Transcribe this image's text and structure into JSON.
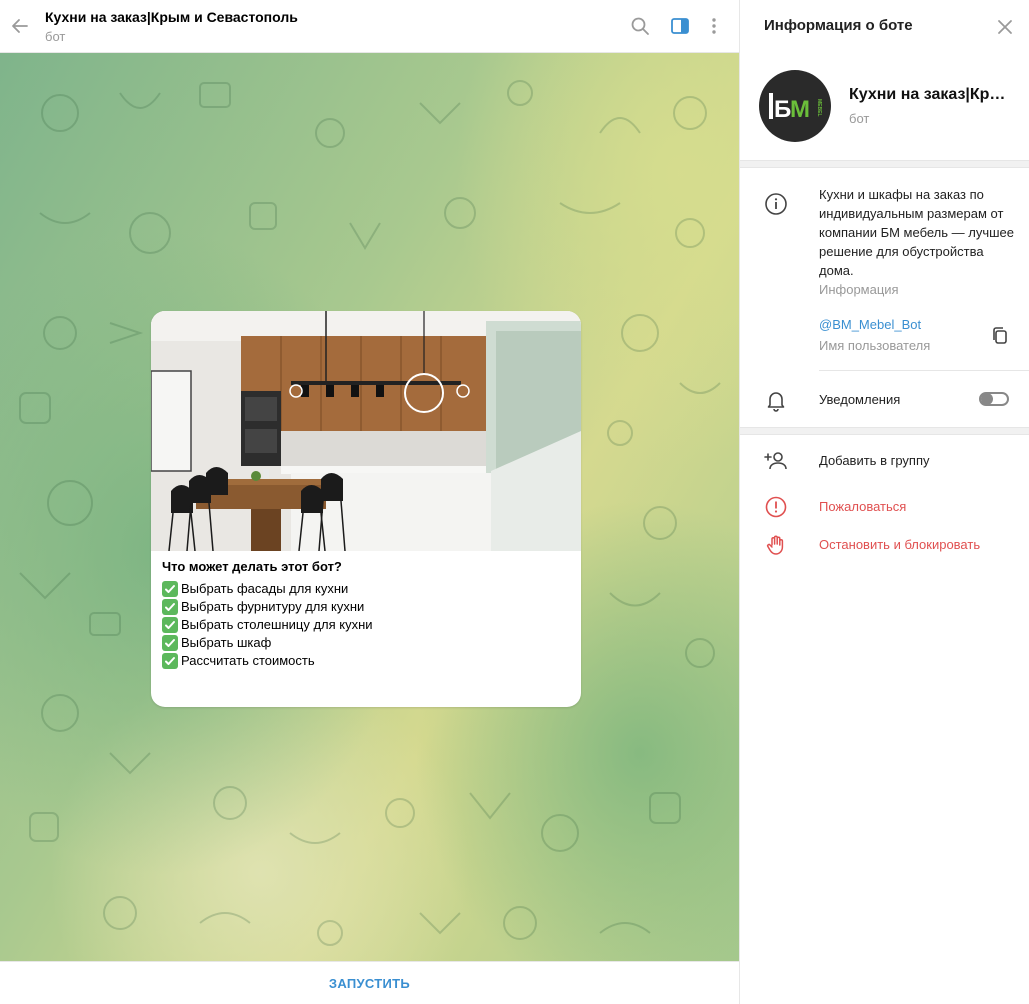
{
  "chat": {
    "title": "Кухни на заказ|Крым и Севастополь",
    "subtitle": "бот",
    "icons": {
      "back": "arrow-left-icon",
      "search": "search-icon",
      "panel": "sidebar-toggle-icon",
      "more": "more-vertical-icon"
    },
    "start_button": "ЗАПУСТИТЬ"
  },
  "message": {
    "title": "Что может делать этот бот?",
    "features": [
      "Выбрать фасады для кухни",
      "Выбрать фурнитуру для кухни",
      "Выбрать столешницу для кухни",
      "Выбрать шкаф",
      "Рассчитать стоимость"
    ],
    "check_icon": "check-mark-button-icon"
  },
  "panel": {
    "title": "Информация о боте",
    "bot_name": "Кухни на заказ|Крым и Севастополь",
    "bot_sub": "бот",
    "avatar_text": "БМ",
    "avatar_small_text": "MEBEL",
    "about": "Кухни и шкафы на заказ по индивидуальным размерам от компании БМ мебель — лучшее решение для обустройства дома.",
    "about_label": "Информация",
    "username": "@BM_Mebel_Bot",
    "username_label": "Имя пользователя",
    "notifications_label": "Уведомления",
    "notifications_on": false,
    "actions": [
      {
        "label": "Добавить в группу",
        "icon": "add-user-icon"
      },
      {
        "label": "Пожаловаться",
        "icon": "alert-circle-icon"
      },
      {
        "label": "Остановить и блокировать",
        "icon": "hand-stop-icon"
      }
    ]
  },
  "colors": {
    "accent": "#3a8fd1",
    "danger": "#e05050",
    "avatar_bg": "#2a2a2a",
    "avatar_green": "#6bbf3a"
  }
}
